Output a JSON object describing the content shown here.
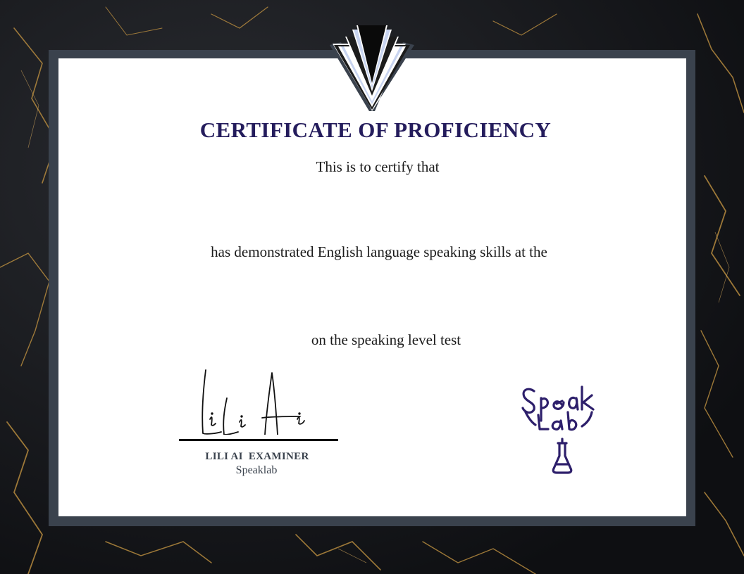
{
  "certificate": {
    "title": "CERTIFICATE OF PROFICIENCY",
    "line_certify": "This is to certify that",
    "line_demonstrated": "has demonstrated English language speaking skills at the",
    "line_test": "on the speaking level test"
  },
  "signatory": {
    "signature_text": "LiLi Ai",
    "name_title": "LILI AI  EXAMINER",
    "organization": "Speaklab"
  },
  "logo": {
    "word_top": "Speak",
    "word_bottom": "Lab",
    "icon": "flask-icon"
  },
  "colors": {
    "title": "#241c5c",
    "frame": "#3a424d",
    "logo": "#2d1f6b",
    "background": "#141518",
    "marble_vein": "#b58a3e"
  }
}
